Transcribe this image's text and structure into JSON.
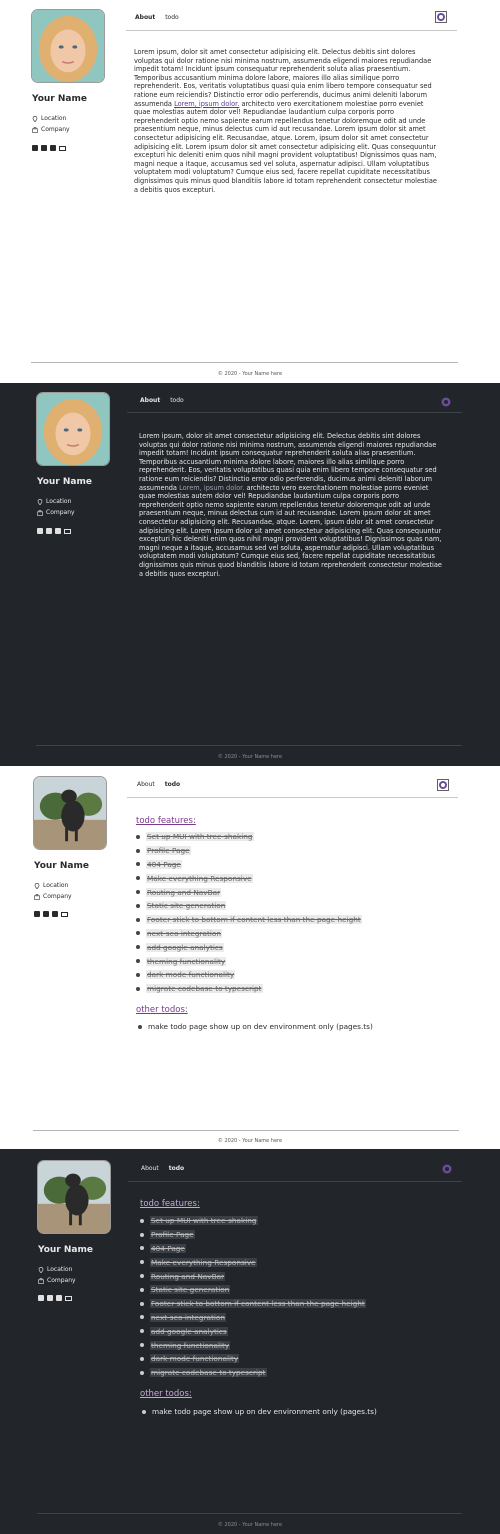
{
  "profile": {
    "name": "Your Name",
    "location": "Location",
    "company": "Company",
    "socials": [
      "linkedin-icon",
      "github-icon",
      "twitter-icon",
      "mail-icon"
    ]
  },
  "nav": {
    "about": "About",
    "todo": "todo"
  },
  "about": {
    "text_before_link": "Lorem ipsum, dolor sit amet consectetur adipisicing elit. Delectus debitis sint dolores voluptas qui dolor ratione nisi minima nostrum, assumenda eligendi maiores repudiandae impedit totam! Incidunt ipsum consequatur reprehenderit soluta alias praesentium. Temporibus accusantium minima dolore labore, maiores illo alias similique porro reprehenderit. Eos, veritatis voluptatibus quasi quia enim libero tempore consequatur sed ratione eum reiciendis? Distinctio error odio perferendis, ducimus animi deleniti laborum assumenda ",
    "link": "Lorem, ipsum dolor.",
    "text_after_link": " architecto vero exercitationem molestiae porro eveniet quae molestias autem dolor vel! Repudiandae laudantium culpa corporis porro reprehenderit optio nemo sapiente earum repellendus tenetur doloremque odit ad unde praesentium neque, minus delectus cum id aut recusandae. Lorem ipsum dolor sit amet consectetur adipisicing elit. Recusandae, atque. Lorem, ipsum dolor sit amet consectetur adipisicing elit. Lorem ipsum dolor sit amet consectetur adipisicing elit. Quas consequuntur excepturi hic deleniti enim quos nihil magni provident voluptatibus! Dignissimos quas nam, magni neque a itaque, accusamus sed vel soluta, aspernatur adipisci. Ullam voluptatibus voluptatem modi voluptatum? Cumque eius sed, facere repellat cupiditate necessitatibus dignissimos quis minus quod blanditiis labore id totam reprehenderit consectetur molestiae a debitis quos excepturi."
  },
  "todo": {
    "features_heading": "todo features:",
    "features": [
      "Set up MUI with tree-shaking",
      "Profile Page",
      "404 Page",
      "Make everything Responsive",
      "Routing and NavBar",
      "Static site generation",
      "Footer stick to bottom if content less than the page height",
      "next-seo integration",
      "add google analytics",
      "theming functionality",
      "dark mode functionality",
      "migrate codebase to typescript"
    ],
    "other_heading": "other todos:",
    "other": [
      "make todo page show up on dev environment only (pages.ts)"
    ]
  },
  "footer": {
    "text": "© 2020 - Your Name here"
  },
  "colors": {
    "light_bg": "#ffffff",
    "dark_bg": "#22262b",
    "accent": "#7a3a8c"
  }
}
